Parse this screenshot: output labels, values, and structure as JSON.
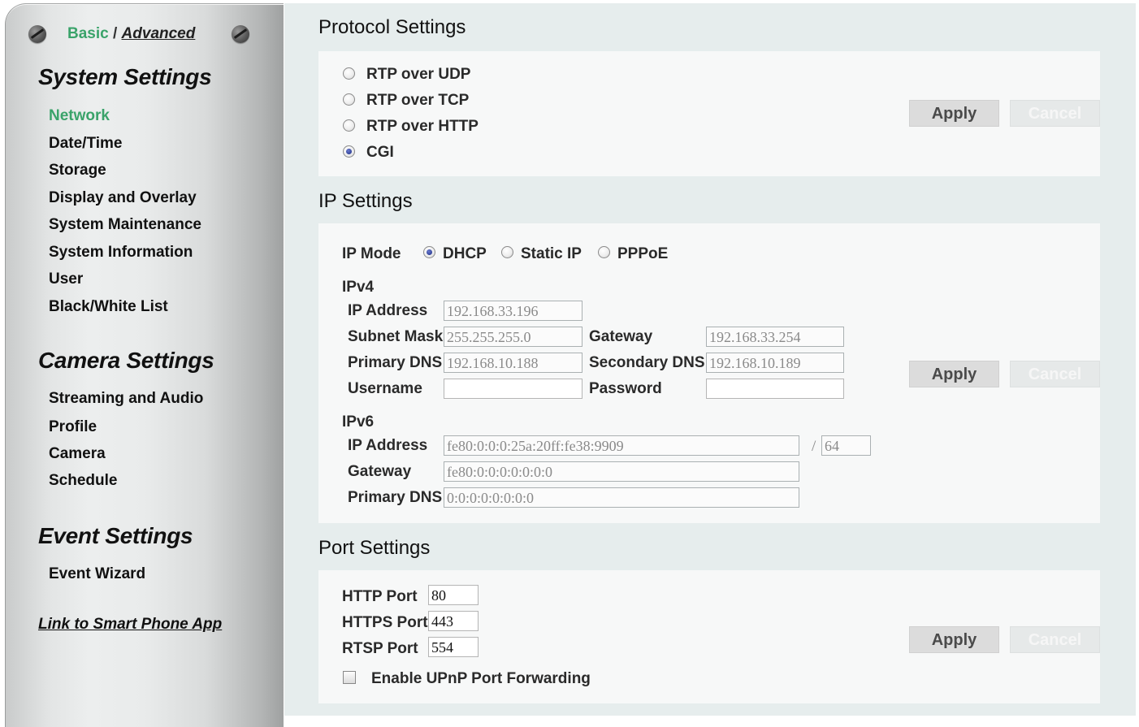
{
  "sidebar": {
    "mode": {
      "basic": "Basic",
      "separator": "/",
      "advanced": "Advanced"
    },
    "system_heading": "System Settings",
    "system_items": [
      "Network",
      "Date/Time",
      "Storage",
      "Display and Overlay",
      "System Maintenance",
      "System Information",
      "User",
      "Black/White List"
    ],
    "camera_heading": "Camera Settings",
    "camera_items": [
      "Streaming and Audio",
      "Profile",
      "Camera",
      "Schedule"
    ],
    "event_heading": "Event Settings",
    "event_items": [
      "Event Wizard"
    ],
    "app_link": "Link to Smart Phone App",
    "active_item": "Network"
  },
  "protocol": {
    "title": "Protocol Settings",
    "options": [
      "RTP over UDP",
      "RTP over TCP",
      "RTP over HTTP",
      "CGI"
    ],
    "selected": "CGI",
    "apply": "Apply",
    "cancel": "Cancel"
  },
  "ip": {
    "title": "IP Settings",
    "mode_label": "IP Mode",
    "modes": [
      "DHCP",
      "Static IP",
      "PPPoE"
    ],
    "selected_mode": "DHCP",
    "ipv4": {
      "heading": "IPv4",
      "ip_address_label": "IP Address",
      "ip_address": "192.168.33.196",
      "subnet_label": "Subnet Mask",
      "subnet": "255.255.255.0",
      "gateway_label": "Gateway",
      "gateway": "192.168.33.254",
      "primary_dns_label": "Primary DNS",
      "primary_dns": "192.168.10.188",
      "secondary_dns_label": "Secondary DNS",
      "secondary_dns": "192.168.10.189",
      "username_label": "Username",
      "username": "",
      "password_label": "Password",
      "password": ""
    },
    "ipv6": {
      "heading": "IPv6",
      "ip_address_label": "IP Address",
      "ip_address": "fe80:0:0:0:25a:20ff:fe38:9909",
      "prefix_sep": "/",
      "prefix": "64",
      "gateway_label": "Gateway",
      "gateway": "fe80:0:0:0:0:0:0:0",
      "primary_dns_label": "Primary DNS",
      "primary_dns": "0:0:0:0:0:0:0:0"
    },
    "apply": "Apply",
    "cancel": "Cancel"
  },
  "port": {
    "title": "Port Settings",
    "http_label": "HTTP Port",
    "http": "80",
    "https_label": "HTTPS Port",
    "https": "443",
    "rtsp_label": "RTSP Port",
    "rtsp": "554",
    "upnp_label": "Enable UPnP Port Forwarding",
    "upnp_checked": false,
    "apply": "Apply",
    "cancel": "Cancel"
  }
}
